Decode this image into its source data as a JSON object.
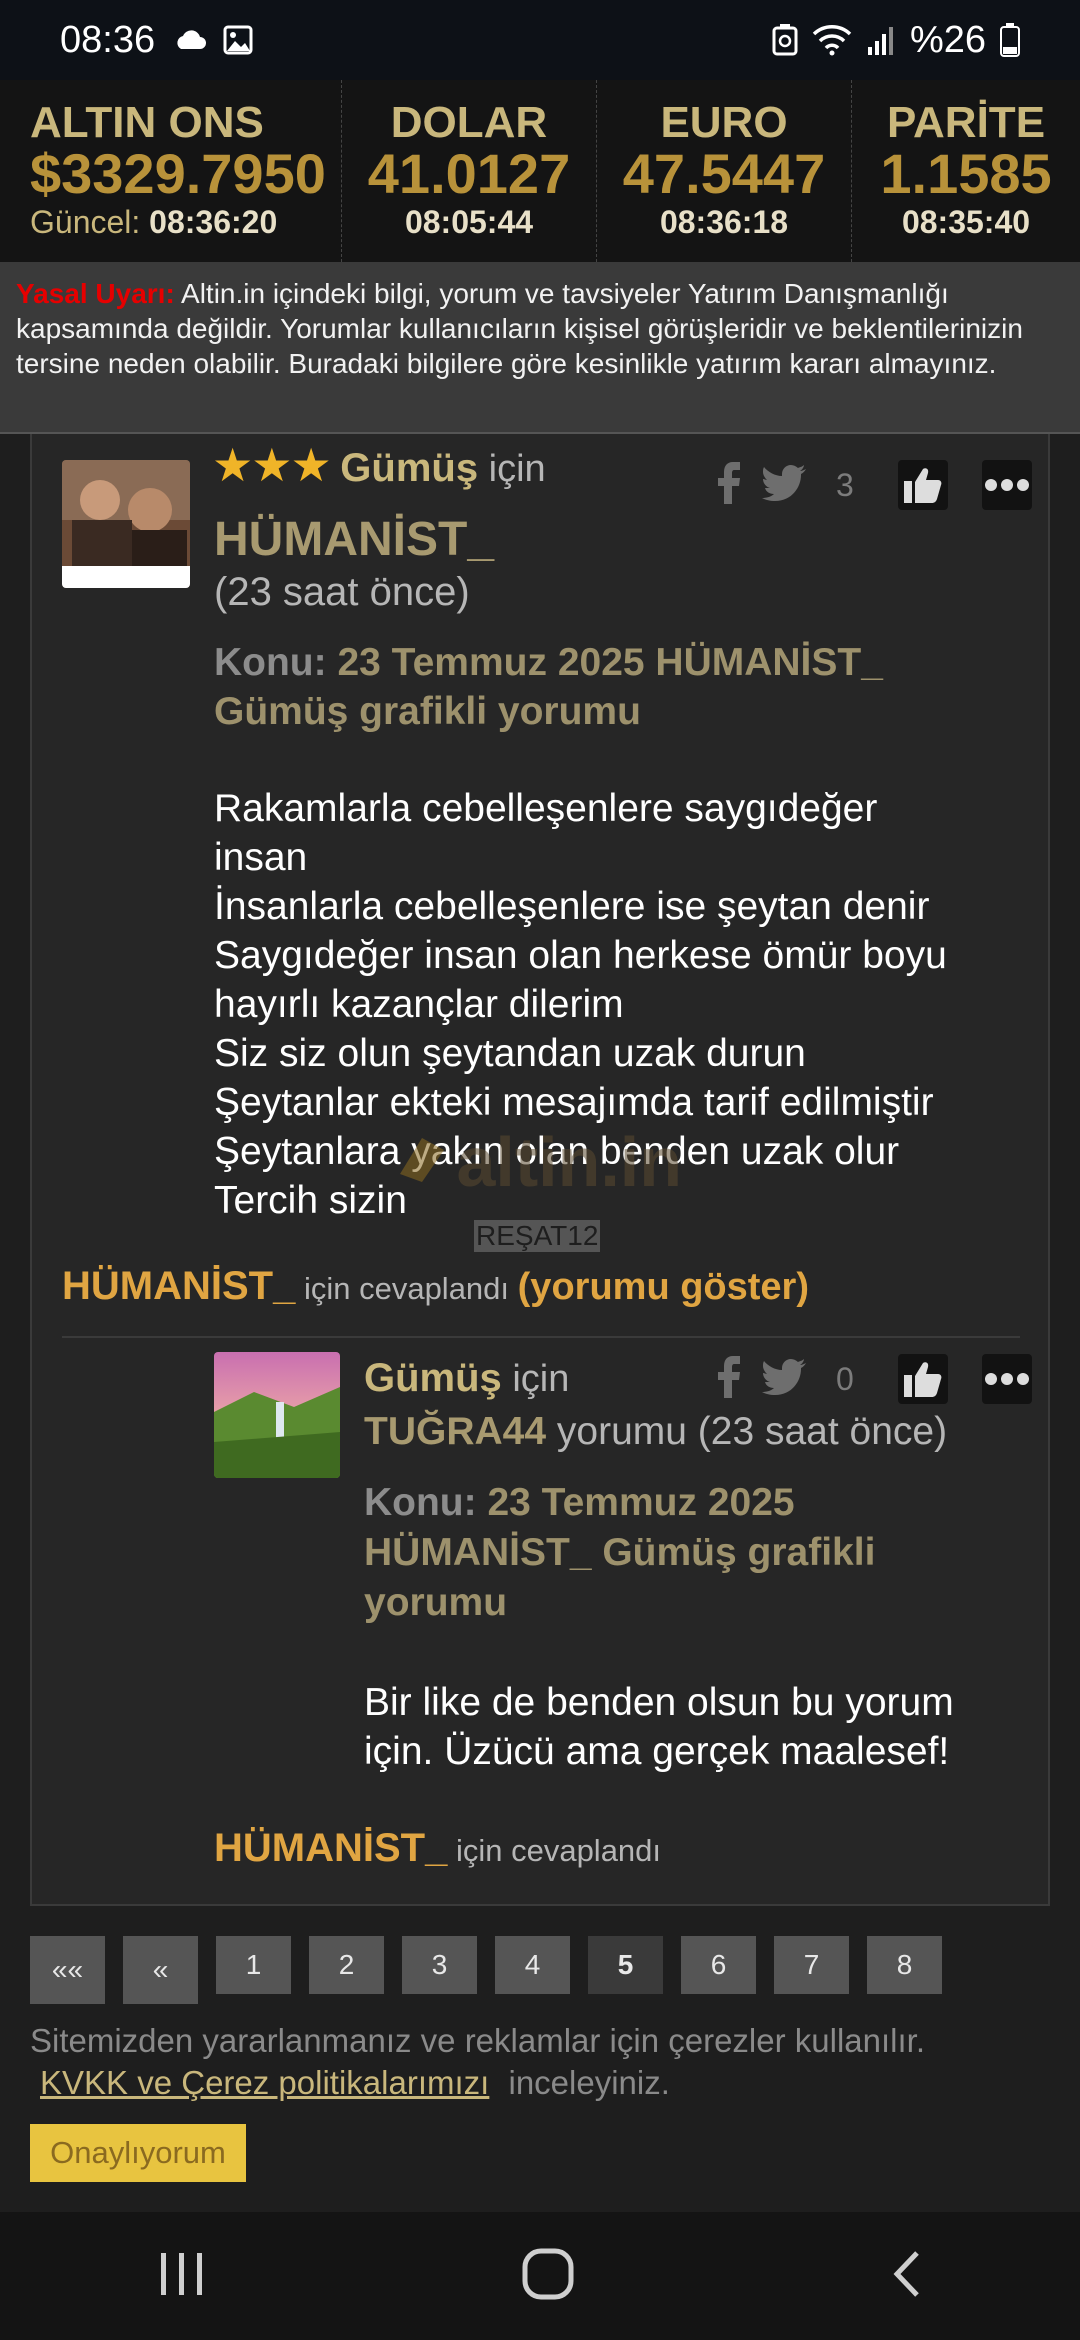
{
  "status_bar": {
    "time": "08:36",
    "battery": "%26",
    "icons": [
      "cloud-icon",
      "image-icon",
      "recycle-icon",
      "wifi-icon",
      "signal-icon",
      "battery-icon"
    ]
  },
  "ticker": [
    {
      "name": "ALTIN ONS",
      "price": "$3329.7950",
      "time_label": "Güncel:",
      "time": "08:36:20"
    },
    {
      "name": "DOLAR",
      "price": "41.0127",
      "time": "08:05:44"
    },
    {
      "name": "EURO",
      "price": "47.5447",
      "time": "08:36:18"
    },
    {
      "name": "PARİTE",
      "price": "1.1585",
      "time": "08:35:40"
    }
  ],
  "warning": {
    "label": "Yasal Uyarı:",
    "text": " Altin.in içindeki bilgi, yorum ve tavsiyeler Yatırım Danışmanlığı kapsamında değildir. Yorumlar kullanıcıların kişisel görüşleridir ve beklentilerinizin tersine neden olabilir. Buradaki bilgilere göre kesinlikle yatırım kararı almayınız."
  },
  "comment1": {
    "stars": "★★★",
    "topic_asset": "Gümüş",
    "for_word": "için",
    "user": "HÜMANİST_",
    "time": "(23 saat önce)",
    "likes": "3",
    "subject_label": "Konu:",
    "subject_line1": "23 Temmuz 2025 HÜMANİST_",
    "subject_line2": "Gümüş grafikli yorumu",
    "body": [
      "Rakamlarla cebelleşenlere saygıdeğer",
      "insan",
      "İnsanlarla cebelleşenlere ise şeytan denir",
      "Saygıdeğer insan olan herkese ömür boyu",
      "hayırlı kazançlar dilerim",
      "Siz siz olun şeytandan uzak durun",
      "Şeytanlar ekteki mesajımda tarif edilmiştir",
      "Şeytanlara yakın olan benden uzak olur",
      "Tercih sizin"
    ],
    "watermark": "altin.in",
    "watermark_user": "REŞAT12"
  },
  "reply_line": {
    "user": "HÜMANİST_",
    "text": " için cevaplandı ",
    "show": "(yorumu göster)"
  },
  "comment2": {
    "topic_asset": "Gümüş",
    "for_word": "için",
    "user": "TUĞRA44",
    "time": "yorumu (23 saat önce)",
    "likes": "0",
    "subject_label": "Konu:",
    "subject_line1": "23 Temmuz 2025",
    "subject_line2": "HÜMANİST_ Gümüş grafikli",
    "subject_line3": "yorumu",
    "body": [
      "Bir like de benden olsun bu yorum",
      "için. Üzücü ama gerçek maalesef!"
    ],
    "reply_user": "HÜMANİST_",
    "reply_text": " için cevaplandı"
  },
  "pagination": {
    "first": "««",
    "prev": "«",
    "pages": [
      "1",
      "2",
      "3",
      "4",
      "5",
      "6",
      "7",
      "8"
    ],
    "current": "5"
  },
  "cookie": {
    "text1": "Sitemizden yararlanmanız ve reklamlar için çerezler kullanılır.",
    "link": "KVKK ve Çerez politikalarımızı",
    "text2": "inceleyiniz.",
    "agree": "Onaylıyorum"
  }
}
